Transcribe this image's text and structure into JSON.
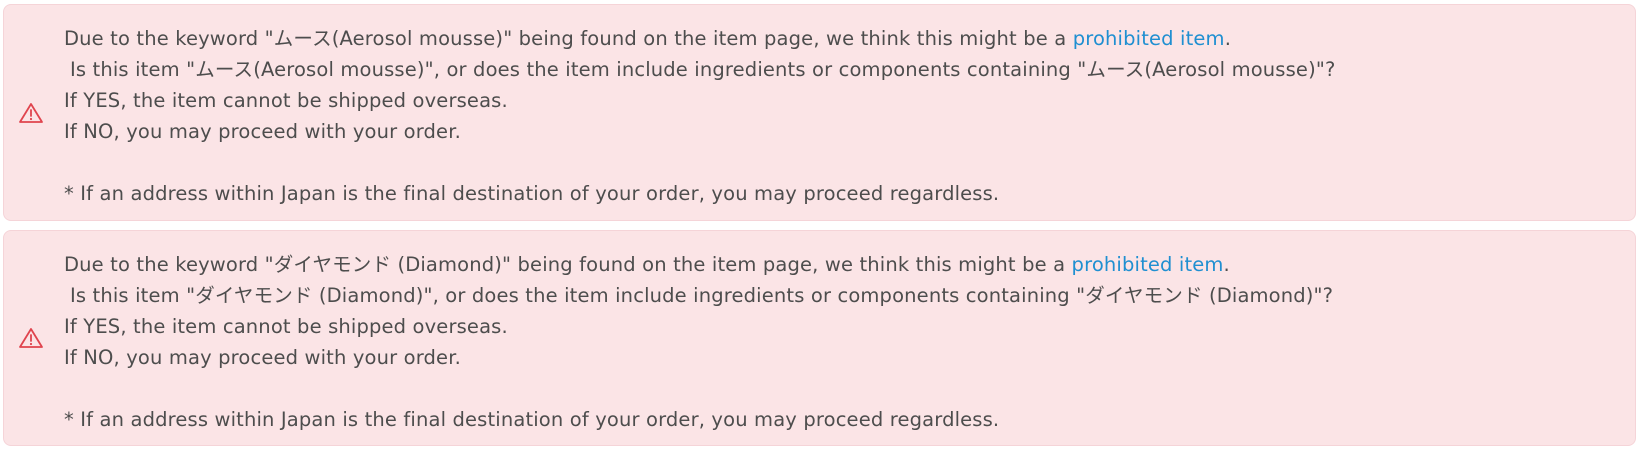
{
  "colors": {
    "alert_background": "#fbe4e6",
    "alert_border": "#f5d4d8",
    "text": "#4d4d4d",
    "link": "#1f8fd1",
    "warning_icon": "#e0444e"
  },
  "alerts": [
    {
      "icon": "warning-triangle-icon",
      "line1_before": "Due to the keyword \"ムース(Aerosol mousse)\" being found on the item page, we think this might be a ",
      "line1_link": "prohibited item",
      "line1_after": ".",
      "line2": "Is this item \"ムース(Aerosol mousse)\", or does the item include ingredients or components containing \"ムース(Aerosol mousse)\"?",
      "line3": "If YES, the item cannot be shipped overseas.",
      "line4": "If NO, you may proceed with your order.",
      "note": "* If an address within Japan is the final destination of your order, you may proceed regardless."
    },
    {
      "icon": "warning-triangle-icon",
      "line1_before": "Due to the keyword \"ダイヤモンド (Diamond)\" being found on the item page, we think this might be a ",
      "line1_link": "prohibited item",
      "line1_after": ".",
      "line2": "Is this item \"ダイヤモンド (Diamond)\", or does the item include ingredients or components containing \"ダイヤモンド (Diamond)\"?",
      "line3": "If YES, the item cannot be shipped overseas.",
      "line4": "If NO, you may proceed with your order.",
      "note": "* If an address within Japan is the final destination of your order, you may proceed regardless."
    }
  ]
}
